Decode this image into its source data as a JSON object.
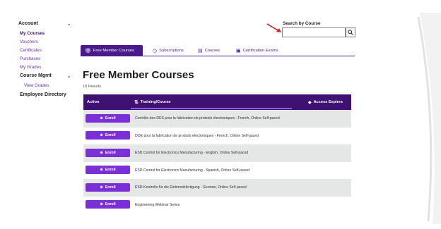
{
  "sidebar": {
    "items": [
      {
        "label": "Account",
        "bold": true
      },
      {
        "label": "My Courses",
        "bold": true
      },
      {
        "label": "Vouchers"
      },
      {
        "label": "Certificates"
      },
      {
        "label": "Purchases"
      },
      {
        "label": "My Grades"
      },
      {
        "label": "Course Mgmt",
        "bold": true
      },
      {
        "label": "View Grades"
      },
      {
        "label": "Employee Directory",
        "bold": true
      }
    ]
  },
  "search": {
    "label": "Search by Course",
    "value": "",
    "placeholder": ""
  },
  "tabs": [
    {
      "label": "Free Member Courses",
      "icon": "gift-icon"
    },
    {
      "label": "Subscriptions",
      "icon": "clock-icon"
    },
    {
      "label": "Courses",
      "icon": "book-icon"
    },
    {
      "label": "Certification Exams",
      "icon": "certificate-icon"
    }
  ],
  "page": {
    "title": "Free Member Courses",
    "results": "18 Results"
  },
  "table": {
    "headers": {
      "action": "Action",
      "course": "Training/Course",
      "expires": "Access Expires"
    },
    "enroll_label": "Enroll",
    "rows": [
      "Contrôle des DES pour la fabrication de produits électroniques - French, Online Self-paced",
      "DOE pour la fabrication de produits électroniques - French, Online Self-paced",
      "ESD Control for Electronics Manufacturing - English, Online Self-paced",
      "ESD Control for Electronics Manufacturing - Spanish, Online Self-paced",
      "ESD-Kontrolle für die Elektronikfertigung - German, Online Self-paced",
      "Engineering Webinar Series"
    ]
  },
  "colors": {
    "brand": "#3f1173",
    "accent": "#7b2fd6",
    "link": "#6b2fb3",
    "annotation_arrow": "#d42020"
  }
}
